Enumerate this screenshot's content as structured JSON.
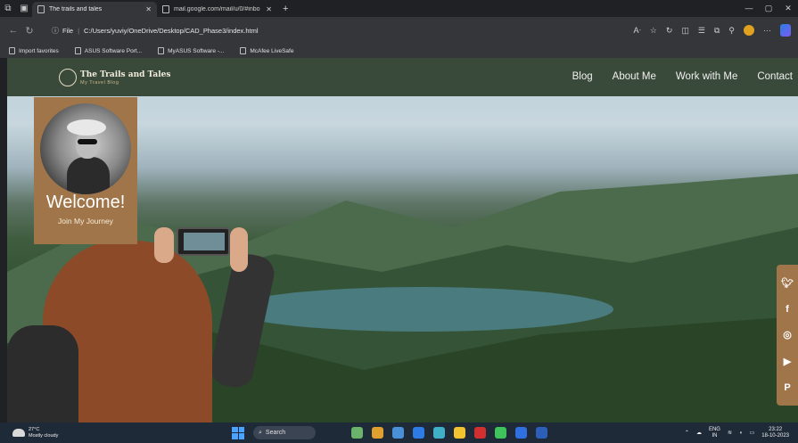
{
  "browser": {
    "tabs": [
      {
        "title": "The trails and tales",
        "active": true
      },
      {
        "title": "mail.google.com/mail/u/0/#inbo",
        "active": false
      }
    ],
    "url_prefix": "File",
    "url": "C:/Users/yuviy/OneDrive/Desktop/CAD_Phase3/index.html",
    "favorites": [
      "Import favorites",
      "ASUS Software Port...",
      "MyASUS Software -...",
      "McAfee LiveSafe"
    ]
  },
  "site": {
    "brand_title": "The Trails and Tales",
    "brand_subtitle": "My Travel Blog",
    "nav": [
      "Blog",
      "About Me",
      "Work with Me",
      "Contact"
    ],
    "welcome": "Welcome!",
    "join": "Join My Journey",
    "social": [
      "twitter-icon",
      "facebook-icon",
      "instagram-icon",
      "youtube-icon",
      "pinterest-icon"
    ],
    "accent": "#a0754a",
    "nav_bg": "#3a4a3a"
  },
  "taskbar": {
    "temp": "27°C",
    "weather": "Mostly cloudy",
    "search": "Search",
    "lang": "ENG",
    "region": "IN",
    "time": "23:22",
    "date": "18-10-2023"
  }
}
